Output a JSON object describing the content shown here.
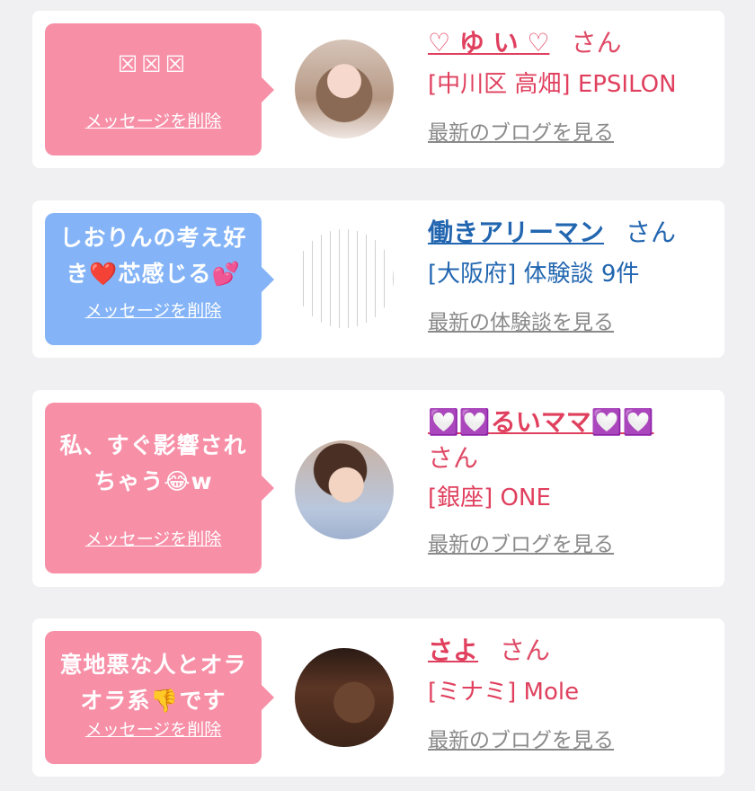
{
  "messages": [
    {
      "message": "☒☒☒",
      "delete_label": "メッセージを削除",
      "name": "♡ ゆ い ♡",
      "honorific": "さん",
      "location": "[中川区 高畑] EPSILON",
      "latest_label": "最新のブログを見る",
      "avatar_icon": "avatar-photo-woman",
      "bubble_color": "#f78fa7"
    },
    {
      "message": "しおりんの考え好き❤️芯感じる💕",
      "delete_label": "メッセージを削除",
      "name": "働きアリーマン",
      "honorific": "さん",
      "location": "[大阪府] 体験談 9件",
      "latest_label": "最新の体験談を見る",
      "avatar_icon": "avatar-photo-handwritten-letter",
      "bubble_color": "#84b4f7"
    },
    {
      "message": "私、すぐ影響されちゃう😂w",
      "delete_label": "メッセージを削除",
      "name": "💟💟るいママ💟💟",
      "honorific": "さん",
      "location": "[銀座] ONE",
      "latest_label": "最新のブログを見る",
      "avatar_icon": "avatar-photo-woman-kimono",
      "bubble_color": "#f78fa7"
    },
    {
      "message": "意地悪な人とオラオラ系👎です",
      "delete_label": "メッセージを削除",
      "name": "さよ",
      "honorific": "さん",
      "location": "[ミナミ] Mole",
      "latest_label": "最新のブログを見る",
      "avatar_icon": "avatar-photo-dim",
      "bubble_color": "#f78fa7"
    }
  ],
  "colors": {
    "pink_text": "#e0405e",
    "blue_text": "#2266b0",
    "link_gray": "#8a8a8a",
    "background": "#f0f0f2"
  }
}
